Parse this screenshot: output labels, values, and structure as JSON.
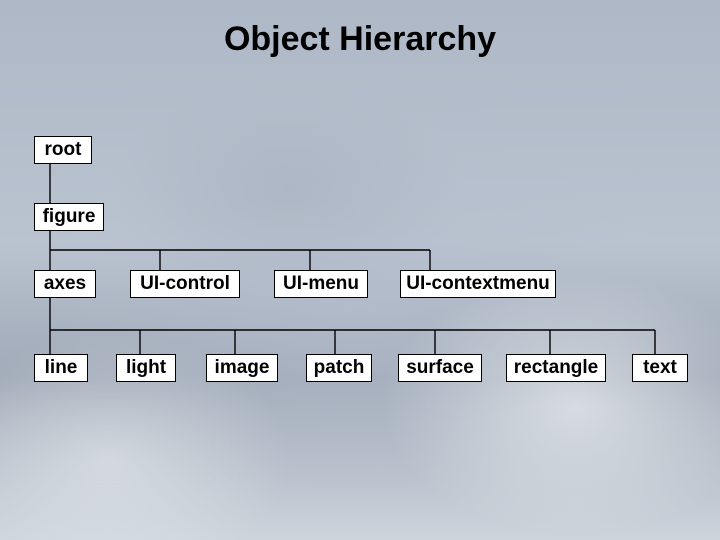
{
  "title": "Object Hierarchy",
  "hierarchy": {
    "root": {
      "label": "root"
    },
    "figure": {
      "label": "figure",
      "children": {
        "axes": {
          "label": "axes"
        },
        "uicontrol": {
          "label": "UI-control"
        },
        "uimenu": {
          "label": "UI-menu"
        },
        "uicontextmenu": {
          "label": "UI-contextmenu"
        }
      }
    },
    "axes_children": {
      "line": {
        "label": "line"
      },
      "light": {
        "label": "light"
      },
      "image": {
        "label": "image"
      },
      "patch": {
        "label": "patch"
      },
      "surface": {
        "label": "surface"
      },
      "rectangle": {
        "label": "rectangle"
      },
      "text": {
        "label": "text"
      }
    }
  }
}
